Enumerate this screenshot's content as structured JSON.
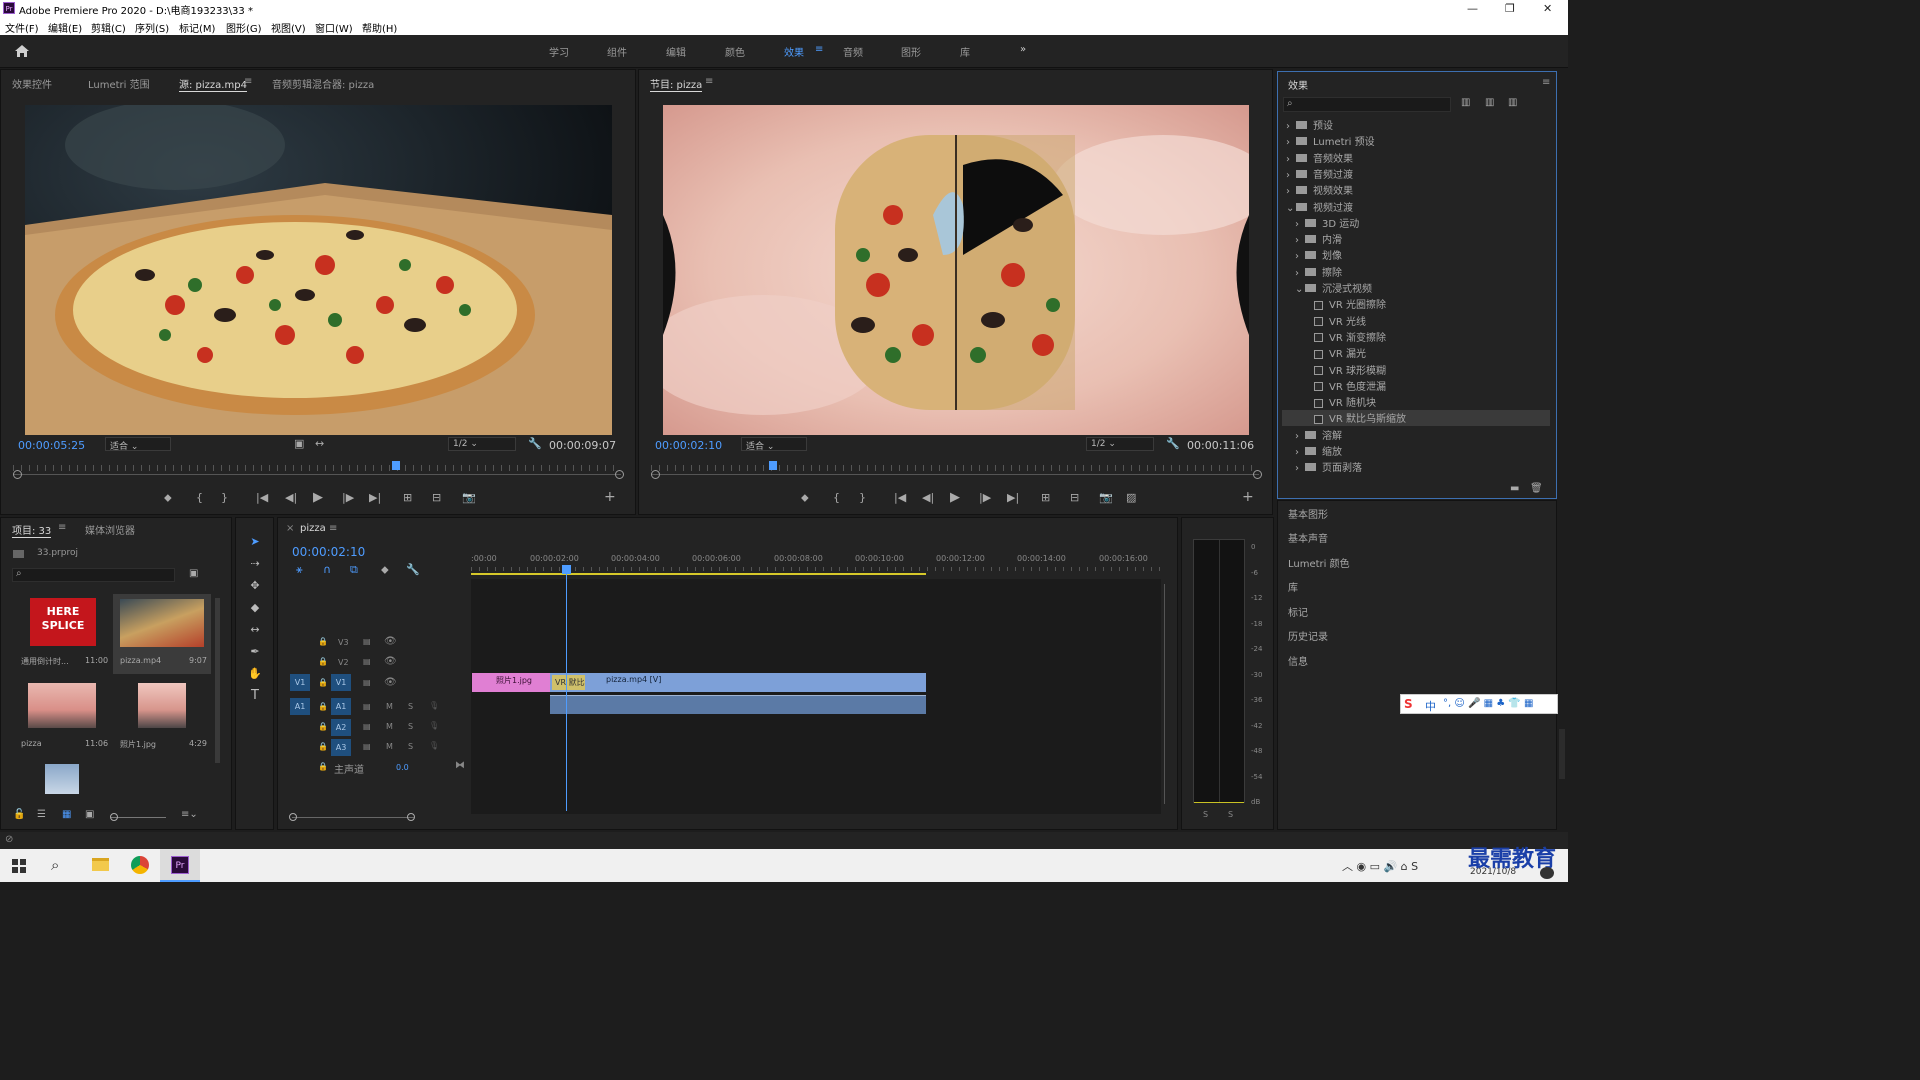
{
  "window": {
    "app_badge": "Pr",
    "title": "Adobe Premiere Pro 2020 - D:\\电商193233\\33 *"
  },
  "menu": [
    "文件(F)",
    "编辑(E)",
    "剪辑(C)",
    "序列(S)",
    "标记(M)",
    "图形(G)",
    "视图(V)",
    "窗口(W)",
    "帮助(H)"
  ],
  "workspaces": [
    "学习",
    "组件",
    "编辑",
    "颜色",
    "效果",
    "音频",
    "图形",
    "库"
  ],
  "active_workspace": "效果",
  "source_panel": {
    "tabs": [
      "效果控件",
      "Lumetri 范围",
      "源: pizza.mp4",
      "音频剪辑混合器: pizza"
    ],
    "active_tab": "源: pizza.mp4",
    "timecode": "00:00:05:25",
    "fit": "适合",
    "resolution": "1/2",
    "duration": "00:00:09:07",
    "playhead_fraction": 0.63
  },
  "program_panel": {
    "tab": "节目: pizza",
    "timecode": "00:00:02:10",
    "fit": "适合",
    "resolution": "1/2",
    "duration": "00:00:11:06",
    "playhead_fraction": 0.2
  },
  "effects_panel": {
    "title": "效果",
    "items": [
      {
        "label": "预设",
        "level": 0,
        "open": false,
        "kind": "bin"
      },
      {
        "label": "Lumetri 预设",
        "level": 0,
        "open": false,
        "kind": "bin"
      },
      {
        "label": "音频效果",
        "level": 0,
        "open": false,
        "kind": "folder"
      },
      {
        "label": "音频过渡",
        "level": 0,
        "open": false,
        "kind": "folder"
      },
      {
        "label": "视频效果",
        "level": 0,
        "open": false,
        "kind": "folder"
      },
      {
        "label": "视频过渡",
        "level": 0,
        "open": true,
        "kind": "folder"
      },
      {
        "label": "3D 运动",
        "level": 1,
        "open": false,
        "kind": "folder"
      },
      {
        "label": "内滑",
        "level": 1,
        "open": false,
        "kind": "folder"
      },
      {
        "label": "划像",
        "level": 1,
        "open": false,
        "kind": "folder"
      },
      {
        "label": "擦除",
        "level": 1,
        "open": false,
        "kind": "folder"
      },
      {
        "label": "沉浸式视频",
        "level": 1,
        "open": true,
        "kind": "folder"
      },
      {
        "label": "VR 光圈擦除",
        "level": 2,
        "kind": "effect"
      },
      {
        "label": "VR 光线",
        "level": 2,
        "kind": "effect"
      },
      {
        "label": "VR 渐变擦除",
        "level": 2,
        "kind": "effect"
      },
      {
        "label": "VR 漏光",
        "level": 2,
        "kind": "effect"
      },
      {
        "label": "VR 球形模糊",
        "level": 2,
        "kind": "effect"
      },
      {
        "label": "VR 色度泄漏",
        "level": 2,
        "kind": "effect"
      },
      {
        "label": "VR 随机块",
        "level": 2,
        "kind": "effect"
      },
      {
        "label": "VR 默比乌斯缩放",
        "level": 2,
        "kind": "effect",
        "selected": true
      },
      {
        "label": "溶解",
        "level": 1,
        "open": false,
        "kind": "folder"
      },
      {
        "label": "缩放",
        "level": 1,
        "open": false,
        "kind": "folder"
      },
      {
        "label": "页面剥落",
        "level": 1,
        "open": false,
        "kind": "folder"
      }
    ]
  },
  "right_panels": [
    "基本图形",
    "基本声音",
    "Lumetri 颜色",
    "库",
    "标记",
    "历史记录",
    "信息"
  ],
  "project_panel": {
    "tabs": [
      "项目: 33",
      "媒体浏览器"
    ],
    "file": "33.prproj",
    "items": [
      {
        "name": "通用倒计时...",
        "duration": "11:00",
        "thumb_text": "HERE SPLICE"
      },
      {
        "name": "pizza.mp4",
        "duration": "9:07"
      },
      {
        "name": "pizza",
        "duration": "11:06"
      },
      {
        "name": "照片1.jpg",
        "duration": "4:29"
      }
    ]
  },
  "timeline": {
    "tab": "pizza",
    "timecode": "00:00:02:10",
    "ruler": [
      ":00:00",
      "00:00:02:00",
      "00:00:04:00",
      "00:00:06:00",
      "00:00:08:00",
      "00:00:10:00",
      "00:00:12:00",
      "00:00:14:00",
      "00:00:16:00"
    ],
    "video_tracks": [
      "V3",
      "V2",
      "V1"
    ],
    "audio_tracks": [
      "A1",
      "A2",
      "A3"
    ],
    "master_label": "主声道",
    "master_value": "0.0",
    "src_v": "V1",
    "src_a": "A1",
    "mute": "M",
    "solo": "S",
    "clips": {
      "photo": "照片1.jpg",
      "transition": "VR 默比",
      "video": "pizza.mp4 [V]"
    }
  },
  "meter": {
    "scale": [
      "0",
      "-6",
      "-12",
      "-18",
      "-24",
      "-30",
      "-36",
      "-42",
      "-48",
      "-54",
      "dB"
    ],
    "solo": [
      "S",
      "S"
    ]
  },
  "ime": {
    "label": "中"
  },
  "watermark": "最需教育",
  "taskbar": {
    "date": "2021/10/8"
  }
}
